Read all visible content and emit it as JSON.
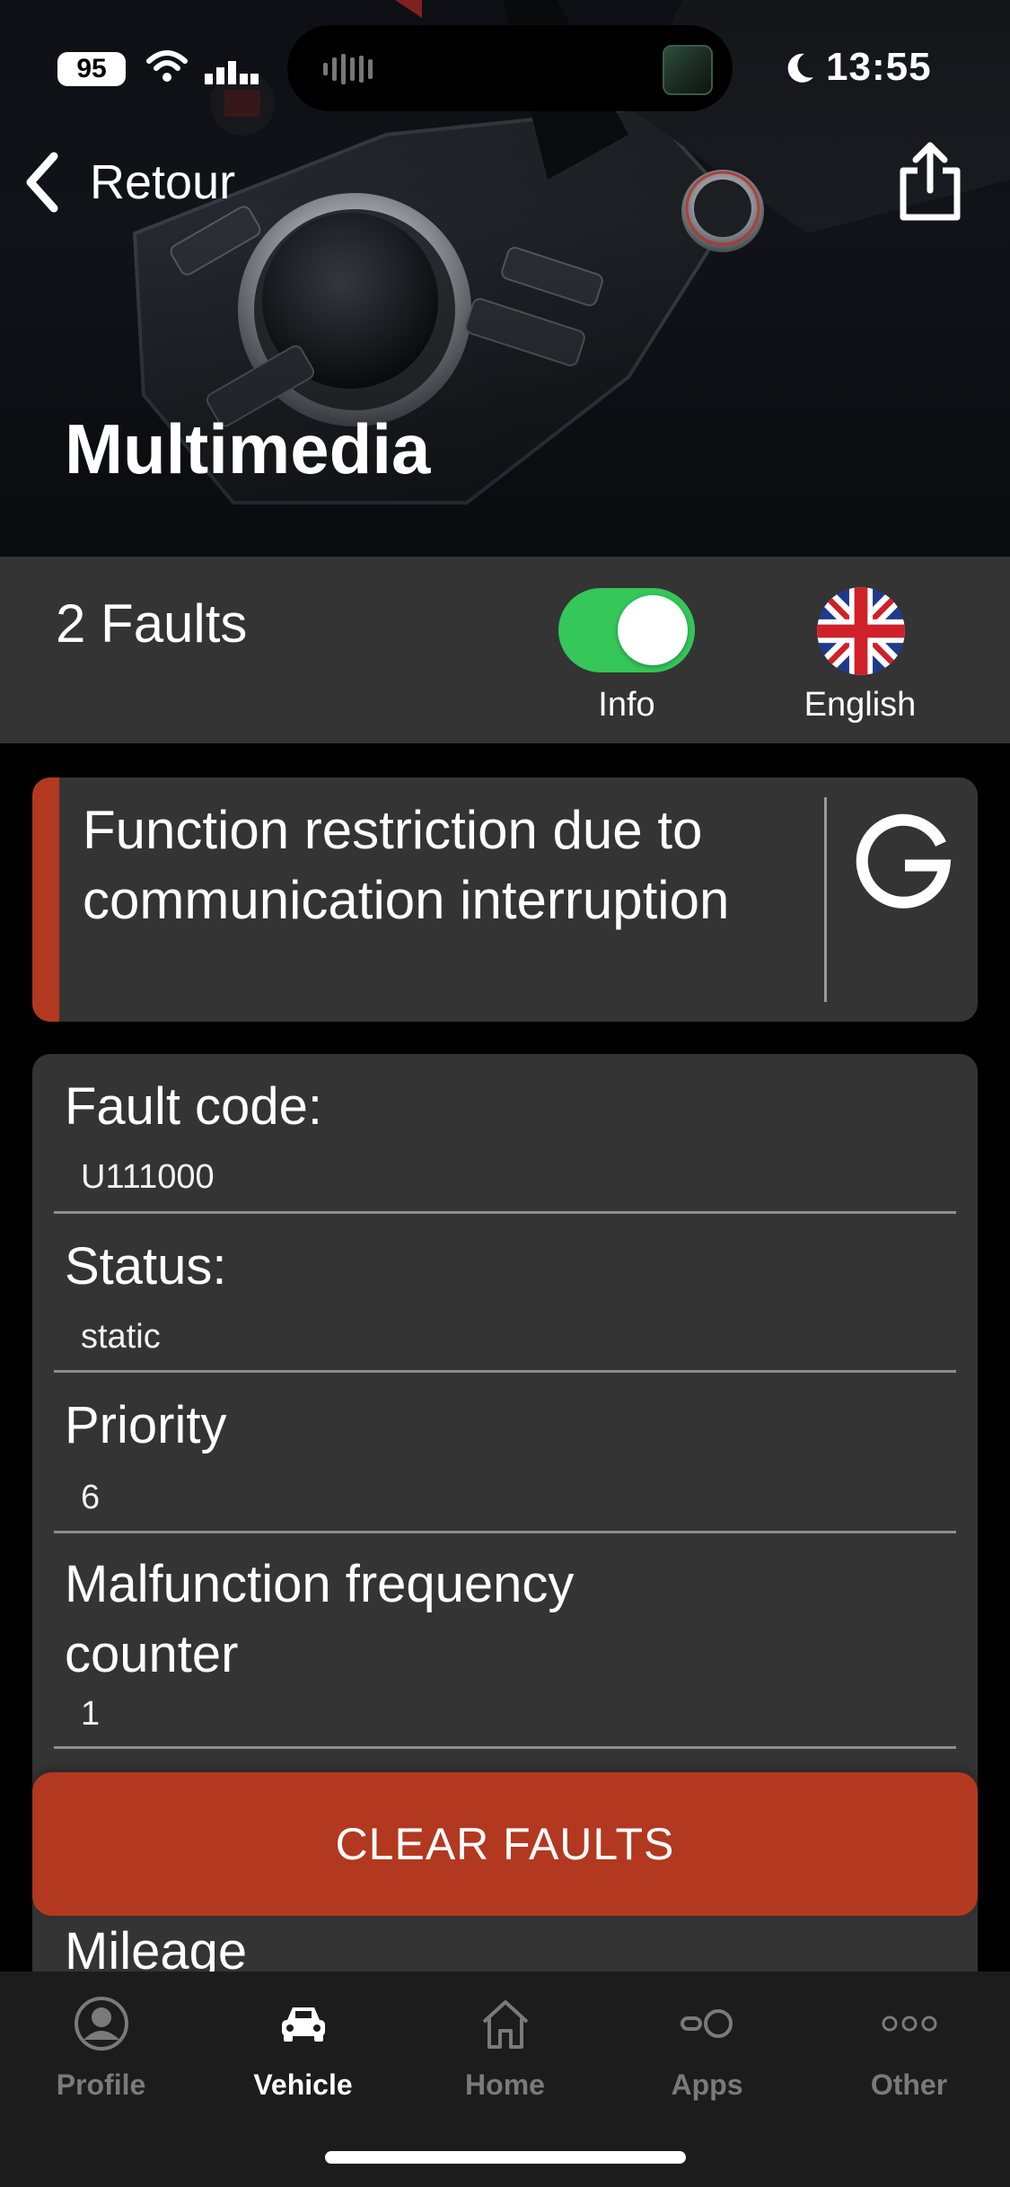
{
  "status_bar": {
    "battery": "95",
    "time": "13:55",
    "icons": [
      "wifi-icon",
      "cellular-icon",
      "moon-icon"
    ]
  },
  "nav": {
    "back_label": "Retour",
    "back_icon": "chevron-left-icon",
    "share_icon": "share-icon"
  },
  "hero": {
    "title": "Multimedia"
  },
  "fault_header": {
    "count_label": "2 Faults",
    "info_toggle": {
      "label": "Info",
      "on": true,
      "color": "#35c759"
    },
    "language": {
      "label": "English",
      "icon": "uk-flag-icon"
    }
  },
  "fault": {
    "title": "Function restriction due to communication interruption",
    "accent_color": "#b33820",
    "translate_icon": "google-icon",
    "fields": [
      {
        "label": "Fault code:",
        "value": "U111000"
      },
      {
        "label": "Status:",
        "value": "static"
      },
      {
        "label": "Priority",
        "value": "6"
      },
      {
        "label": "Malfunction frequency counter",
        "value": "1"
      }
    ],
    "next_field_label": "Mileage"
  },
  "actions": {
    "clear_label": "CLEAR FAULTS"
  },
  "tabbar": {
    "tabs": [
      {
        "label": "Profile",
        "icon": "profile-icon",
        "active": false
      },
      {
        "label": "Vehicle",
        "icon": "car-icon",
        "active": true
      },
      {
        "label": "Home",
        "icon": "home-icon",
        "active": false
      },
      {
        "label": "Apps",
        "icon": "apps-icon",
        "active": false
      },
      {
        "label": "Other",
        "icon": "more-icon",
        "active": false
      }
    ]
  }
}
